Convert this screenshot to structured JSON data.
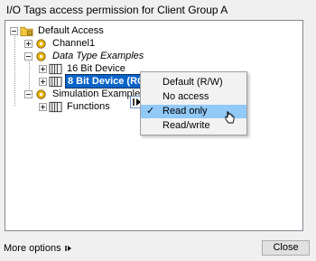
{
  "window": {
    "title": "I/O Tags access permission for Client Group A"
  },
  "tree": {
    "root": "Default Access",
    "channel1": "Channel1",
    "data_type_examples": "Data Type Examples",
    "device_16bit": "16 Bit Device",
    "device_8bit": "8 Bit Device (RO)",
    "simulation_examples": "Simulation Examples",
    "functions": "Functions"
  },
  "context_menu": {
    "items": [
      {
        "label": "Default (R/W)",
        "checked": false
      },
      {
        "label": "No access",
        "checked": false
      },
      {
        "label": "Read only",
        "checked": true,
        "hovered": true
      },
      {
        "label": "Read/write",
        "checked": false
      }
    ],
    "check_glyph": "✓"
  },
  "footer": {
    "more_options": "More options",
    "close": "Close"
  },
  "colors": {
    "selection": "#0a64c8",
    "menu_hover": "#91c9f7",
    "folder": "#f5c542",
    "gear": "#e8b400"
  }
}
